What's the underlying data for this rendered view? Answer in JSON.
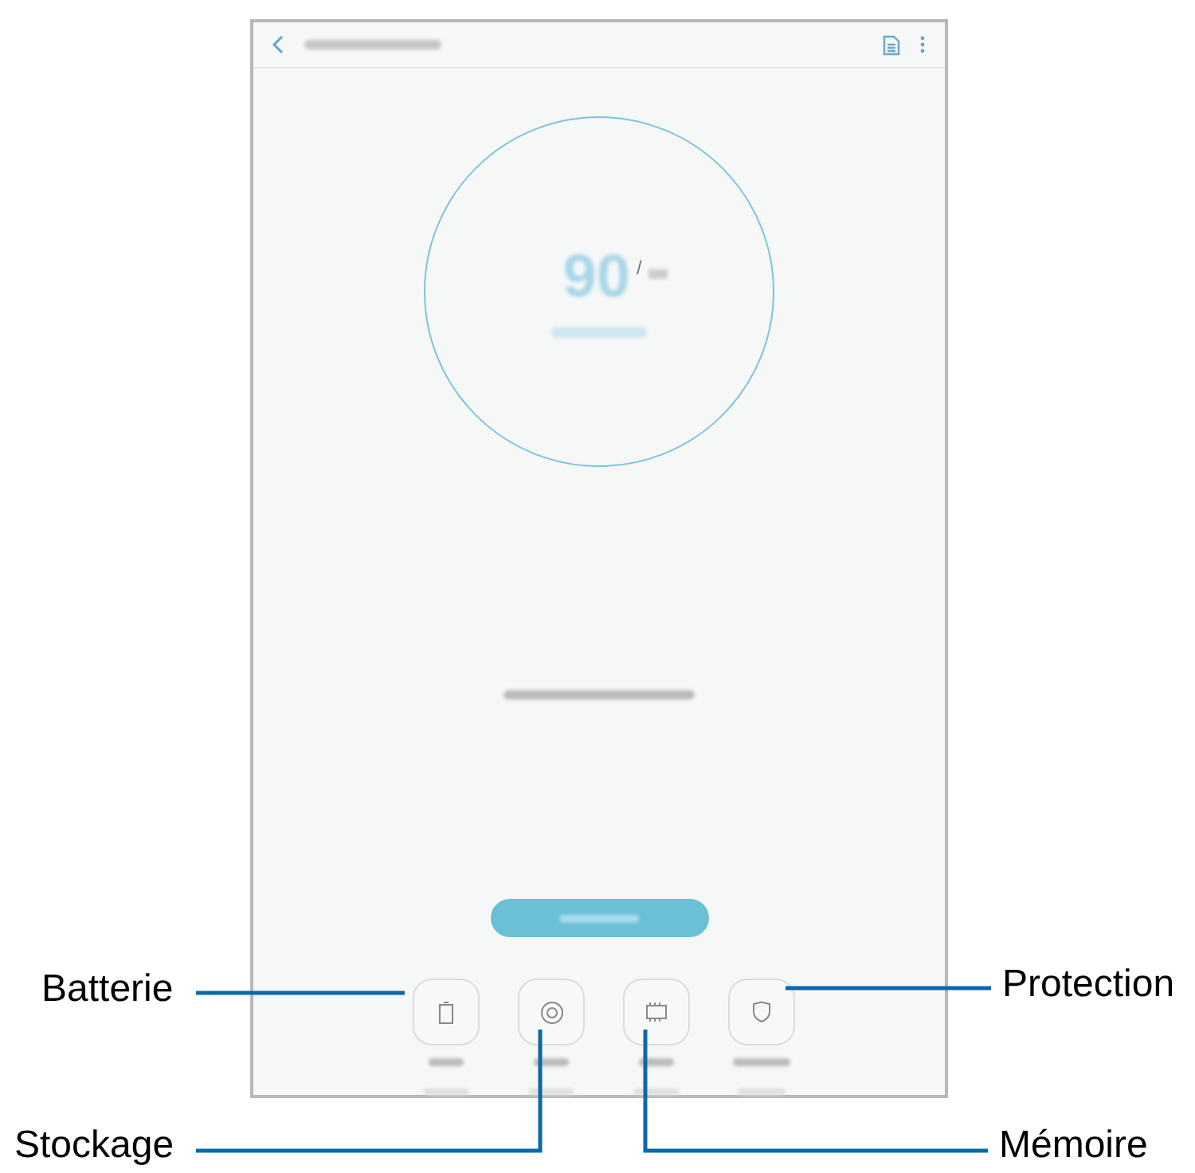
{
  "screen": {
    "score": "90",
    "score_separator": "/"
  },
  "callouts": [
    {
      "label": "Batterie"
    },
    {
      "label": "Protection"
    },
    {
      "label": "Stockage"
    },
    {
      "label": "Mémoire"
    }
  ]
}
